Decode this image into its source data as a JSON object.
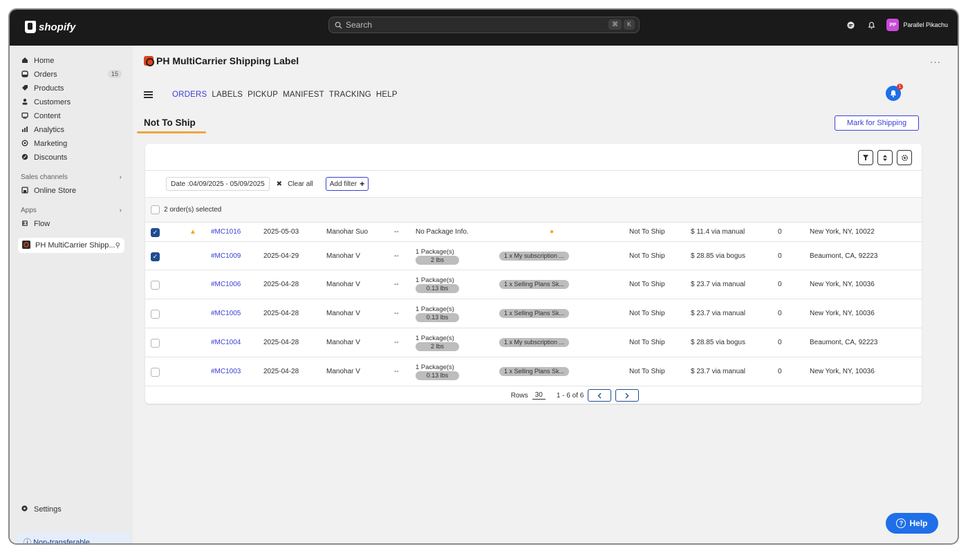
{
  "topbar": {
    "logo_text": "shopify",
    "search_placeholder": "Search",
    "shortcut_keys": [
      "⌘",
      "K"
    ],
    "user_initials": "PP",
    "store_name": "Parallel Pikachu"
  },
  "sidebar": {
    "items": [
      {
        "label": "Home",
        "icon": "home-icon"
      },
      {
        "label": "Orders",
        "icon": "orders-icon",
        "count": "15"
      },
      {
        "label": "Products",
        "icon": "tag-icon"
      },
      {
        "label": "Customers",
        "icon": "person-icon"
      },
      {
        "label": "Content",
        "icon": "content-icon"
      },
      {
        "label": "Analytics",
        "icon": "analytics-icon"
      },
      {
        "label": "Marketing",
        "icon": "marketing-icon"
      },
      {
        "label": "Discounts",
        "icon": "discount-icon"
      }
    ],
    "sales_channels_title": "Sales channels",
    "online_store": "Online Store",
    "apps_title": "Apps",
    "flow": "Flow",
    "active_app": "PH MultiCarrier Shipp...",
    "settings": "Settings",
    "non_transferable": "Non-transferable"
  },
  "app": {
    "title": "PH MultiCarrier Shipping Label",
    "more": "···",
    "menu": [
      "ORDERS",
      "LABELS",
      "PICKUP",
      "MANIFEST",
      "TRACKING",
      "HELP"
    ],
    "notification_count": "1",
    "page_heading": "Not To Ship",
    "mark_button": "Mark for Shipping"
  },
  "filters": {
    "date_chip": "Date :04/09/2025 - 05/09/2025",
    "clear_all": "Clear all",
    "add_filter": "Add filter"
  },
  "table": {
    "selected_text": "2 order(s) selected",
    "rows": [
      {
        "checked": true,
        "warn": true,
        "id": "#MC1016",
        "date": "2025-05-03",
        "customer": "Manohar Suo",
        "dash": "--",
        "package_line": "No Package Info.",
        "weight": "",
        "item": "",
        "info": true,
        "status": "Not To Ship",
        "amount": "$ 11.4 via manual",
        "zero": "0",
        "address": "New York, NY, 10022"
      },
      {
        "checked": true,
        "warn": false,
        "id": "#MC1009",
        "date": "2025-04-29",
        "customer": "Manohar V",
        "dash": "--",
        "package_line": "1 Package(s)",
        "weight": "2 lbs",
        "item": "1 x My subscription ...",
        "info": false,
        "status": "Not To Ship",
        "amount": "$ 28.85 via bogus",
        "zero": "0",
        "address": "Beaumont, CA, 92223"
      },
      {
        "checked": false,
        "warn": false,
        "id": "#MC1006",
        "date": "2025-04-28",
        "customer": "Manohar V",
        "dash": "--",
        "package_line": "1 Package(s)",
        "weight": "0.13 lbs",
        "item": "1 x Selling Plans Sk...",
        "info": false,
        "status": "Not To Ship",
        "amount": "$ 23.7 via manual",
        "zero": "0",
        "address": "New York, NY, 10036"
      },
      {
        "checked": false,
        "warn": false,
        "id": "#MC1005",
        "date": "2025-04-28",
        "customer": "Manohar V",
        "dash": "--",
        "package_line": "1 Package(s)",
        "weight": "0.13 lbs",
        "item": "1 x Selling Plans Sk...",
        "info": false,
        "status": "Not To Ship",
        "amount": "$ 23.7 via manual",
        "zero": "0",
        "address": "New York, NY, 10036"
      },
      {
        "checked": false,
        "warn": false,
        "id": "#MC1004",
        "date": "2025-04-28",
        "customer": "Manohar V",
        "dash": "--",
        "package_line": "1 Package(s)",
        "weight": "2 lbs",
        "item": "1 x My subscription ...",
        "info": false,
        "status": "Not To Ship",
        "amount": "$ 28.85 via bogus",
        "zero": "0",
        "address": "Beaumont, CA, 92223"
      },
      {
        "checked": false,
        "warn": false,
        "id": "#MC1003",
        "date": "2025-04-28",
        "customer": "Manohar V",
        "dash": "--",
        "package_line": "1 Package(s)",
        "weight": "0.13 lbs",
        "item": "1 x Selling Plans Sk...",
        "info": false,
        "status": "Not To Ship",
        "amount": "$ 23.7 via manual",
        "zero": "0",
        "address": "New York, NY, 10036"
      }
    ]
  },
  "pagination": {
    "rows_label": "Rows",
    "rows_value": "30",
    "range": "1 - 6 of 6"
  },
  "help": {
    "label": "Help"
  },
  "colors": {
    "accent": "#3b3fd6",
    "checkbox": "#1f4c8f",
    "heading_underline": "#f0a43c",
    "help_button": "#1f6fe8"
  }
}
